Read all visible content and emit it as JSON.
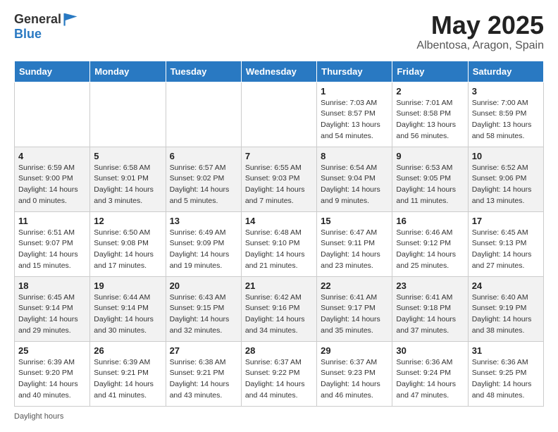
{
  "header": {
    "logo_line1": "General",
    "logo_line2": "Blue",
    "title": "May 2025",
    "location": "Albentosa, Aragon, Spain"
  },
  "days_of_week": [
    "Sunday",
    "Monday",
    "Tuesday",
    "Wednesday",
    "Thursday",
    "Friday",
    "Saturday"
  ],
  "footer_note": "Daylight hours",
  "weeks": [
    [
      {
        "day": "",
        "info": ""
      },
      {
        "day": "",
        "info": ""
      },
      {
        "day": "",
        "info": ""
      },
      {
        "day": "",
        "info": ""
      },
      {
        "day": "1",
        "sunrise": "Sunrise: 7:03 AM",
        "sunset": "Sunset: 8:57 PM",
        "daylight": "Daylight: 13 hours and 54 minutes."
      },
      {
        "day": "2",
        "sunrise": "Sunrise: 7:01 AM",
        "sunset": "Sunset: 8:58 PM",
        "daylight": "Daylight: 13 hours and 56 minutes."
      },
      {
        "day": "3",
        "sunrise": "Sunrise: 7:00 AM",
        "sunset": "Sunset: 8:59 PM",
        "daylight": "Daylight: 13 hours and 58 minutes."
      }
    ],
    [
      {
        "day": "4",
        "sunrise": "Sunrise: 6:59 AM",
        "sunset": "Sunset: 9:00 PM",
        "daylight": "Daylight: 14 hours and 0 minutes."
      },
      {
        "day": "5",
        "sunrise": "Sunrise: 6:58 AM",
        "sunset": "Sunset: 9:01 PM",
        "daylight": "Daylight: 14 hours and 3 minutes."
      },
      {
        "day": "6",
        "sunrise": "Sunrise: 6:57 AM",
        "sunset": "Sunset: 9:02 PM",
        "daylight": "Daylight: 14 hours and 5 minutes."
      },
      {
        "day": "7",
        "sunrise": "Sunrise: 6:55 AM",
        "sunset": "Sunset: 9:03 PM",
        "daylight": "Daylight: 14 hours and 7 minutes."
      },
      {
        "day": "8",
        "sunrise": "Sunrise: 6:54 AM",
        "sunset": "Sunset: 9:04 PM",
        "daylight": "Daylight: 14 hours and 9 minutes."
      },
      {
        "day": "9",
        "sunrise": "Sunrise: 6:53 AM",
        "sunset": "Sunset: 9:05 PM",
        "daylight": "Daylight: 14 hours and 11 minutes."
      },
      {
        "day": "10",
        "sunrise": "Sunrise: 6:52 AM",
        "sunset": "Sunset: 9:06 PM",
        "daylight": "Daylight: 14 hours and 13 minutes."
      }
    ],
    [
      {
        "day": "11",
        "sunrise": "Sunrise: 6:51 AM",
        "sunset": "Sunset: 9:07 PM",
        "daylight": "Daylight: 14 hours and 15 minutes."
      },
      {
        "day": "12",
        "sunrise": "Sunrise: 6:50 AM",
        "sunset": "Sunset: 9:08 PM",
        "daylight": "Daylight: 14 hours and 17 minutes."
      },
      {
        "day": "13",
        "sunrise": "Sunrise: 6:49 AM",
        "sunset": "Sunset: 9:09 PM",
        "daylight": "Daylight: 14 hours and 19 minutes."
      },
      {
        "day": "14",
        "sunrise": "Sunrise: 6:48 AM",
        "sunset": "Sunset: 9:10 PM",
        "daylight": "Daylight: 14 hours and 21 minutes."
      },
      {
        "day": "15",
        "sunrise": "Sunrise: 6:47 AM",
        "sunset": "Sunset: 9:11 PM",
        "daylight": "Daylight: 14 hours and 23 minutes."
      },
      {
        "day": "16",
        "sunrise": "Sunrise: 6:46 AM",
        "sunset": "Sunset: 9:12 PM",
        "daylight": "Daylight: 14 hours and 25 minutes."
      },
      {
        "day": "17",
        "sunrise": "Sunrise: 6:45 AM",
        "sunset": "Sunset: 9:13 PM",
        "daylight": "Daylight: 14 hours and 27 minutes."
      }
    ],
    [
      {
        "day": "18",
        "sunrise": "Sunrise: 6:45 AM",
        "sunset": "Sunset: 9:14 PM",
        "daylight": "Daylight: 14 hours and 29 minutes."
      },
      {
        "day": "19",
        "sunrise": "Sunrise: 6:44 AM",
        "sunset": "Sunset: 9:14 PM",
        "daylight": "Daylight: 14 hours and 30 minutes."
      },
      {
        "day": "20",
        "sunrise": "Sunrise: 6:43 AM",
        "sunset": "Sunset: 9:15 PM",
        "daylight": "Daylight: 14 hours and 32 minutes."
      },
      {
        "day": "21",
        "sunrise": "Sunrise: 6:42 AM",
        "sunset": "Sunset: 9:16 PM",
        "daylight": "Daylight: 14 hours and 34 minutes."
      },
      {
        "day": "22",
        "sunrise": "Sunrise: 6:41 AM",
        "sunset": "Sunset: 9:17 PM",
        "daylight": "Daylight: 14 hours and 35 minutes."
      },
      {
        "day": "23",
        "sunrise": "Sunrise: 6:41 AM",
        "sunset": "Sunset: 9:18 PM",
        "daylight": "Daylight: 14 hours and 37 minutes."
      },
      {
        "day": "24",
        "sunrise": "Sunrise: 6:40 AM",
        "sunset": "Sunset: 9:19 PM",
        "daylight": "Daylight: 14 hours and 38 minutes."
      }
    ],
    [
      {
        "day": "25",
        "sunrise": "Sunrise: 6:39 AM",
        "sunset": "Sunset: 9:20 PM",
        "daylight": "Daylight: 14 hours and 40 minutes."
      },
      {
        "day": "26",
        "sunrise": "Sunrise: 6:39 AM",
        "sunset": "Sunset: 9:21 PM",
        "daylight": "Daylight: 14 hours and 41 minutes."
      },
      {
        "day": "27",
        "sunrise": "Sunrise: 6:38 AM",
        "sunset": "Sunset: 9:21 PM",
        "daylight": "Daylight: 14 hours and 43 minutes."
      },
      {
        "day": "28",
        "sunrise": "Sunrise: 6:37 AM",
        "sunset": "Sunset: 9:22 PM",
        "daylight": "Daylight: 14 hours and 44 minutes."
      },
      {
        "day": "29",
        "sunrise": "Sunrise: 6:37 AM",
        "sunset": "Sunset: 9:23 PM",
        "daylight": "Daylight: 14 hours and 46 minutes."
      },
      {
        "day": "30",
        "sunrise": "Sunrise: 6:36 AM",
        "sunset": "Sunset: 9:24 PM",
        "daylight": "Daylight: 14 hours and 47 minutes."
      },
      {
        "day": "31",
        "sunrise": "Sunrise: 6:36 AM",
        "sunset": "Sunset: 9:25 PM",
        "daylight": "Daylight: 14 hours and 48 minutes."
      }
    ]
  ]
}
